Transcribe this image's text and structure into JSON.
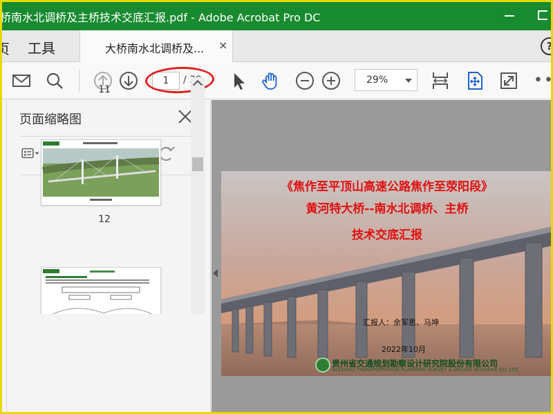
{
  "window": {
    "watermark": "",
    "title": "桥南水北调桥及主桥技术交底汇报.pdf - Adobe Acrobat Pro DC"
  },
  "tabs": {
    "home_fragment": "页",
    "tools": "工具",
    "doc_tab_label": "大桥南水北调桥及...",
    "close_glyph": "×",
    "help_glyph": "?"
  },
  "toolbar": {
    "current_page": "1",
    "total_pages": "/ 39",
    "zoom": "29%",
    "more_glyph": "•••",
    "icons": [
      "mail-icon",
      "search-icon",
      "prev-page-icon",
      "next-page-icon",
      "select-cursor-icon",
      "hand-tool-icon",
      "zoom-out-icon",
      "zoom-in-icon",
      "fit-width-icon",
      "fit-page-icon",
      "fullscreen-icon"
    ]
  },
  "sidebar": {
    "title": "页面缩略图",
    "pages": [
      "11",
      "12"
    ]
  },
  "slide": {
    "line1": "《焦作至平顶山高速公路焦作至荥阳段》",
    "line2": "黄河特大桥--南水北调桥、主桥",
    "line3": "技术交底汇报",
    "reporter": "汇报人：余军思、马坤",
    "date": "2022年10月",
    "org": "贵州省交通规划勘察设计研究院股份有限公司",
    "org_en": "GUIZHOU TRANSPORTATION PLANNING SURVEY & DESIGN ACADEME CO.,LTD."
  },
  "colors": {
    "titlebar": "#188a2f",
    "accent_blue": "#1a73e8",
    "annotation_red": "#e0201f"
  }
}
